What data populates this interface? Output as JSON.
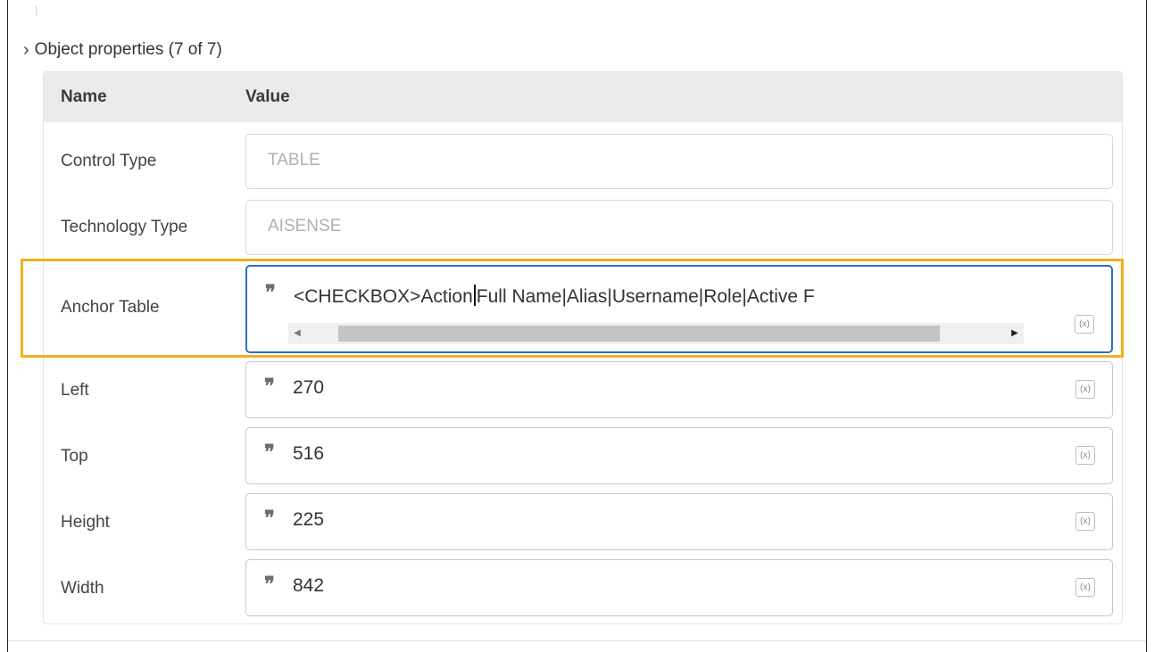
{
  "section": {
    "chevron": "chevron-right-icon",
    "title": "Object properties (7 of 7)"
  },
  "table": {
    "header": {
      "name": "Name",
      "value": "Value"
    },
    "rows": [
      {
        "label": "Control Type",
        "value": "TABLE",
        "readonly": true
      },
      {
        "label": "Technology Type",
        "value": "AISENSE",
        "readonly": true
      },
      {
        "label": "Anchor Table",
        "value_before_caret": "<CHECKBOX>Action",
        "value_after_caret": "Full Name|Alias|Username|Role|Active F",
        "focused": true
      },
      {
        "label": "Left",
        "value": "270"
      },
      {
        "label": "Top",
        "value": "516"
      },
      {
        "label": "Height",
        "value": "225"
      },
      {
        "label": "Width",
        "value": "842"
      }
    ]
  },
  "icons": {
    "quote": "❞",
    "variable_button": "(x)"
  },
  "colors": {
    "highlight": "#f2b01e",
    "focus": "#2d6fc5",
    "header_bg": "#ebebeb"
  }
}
